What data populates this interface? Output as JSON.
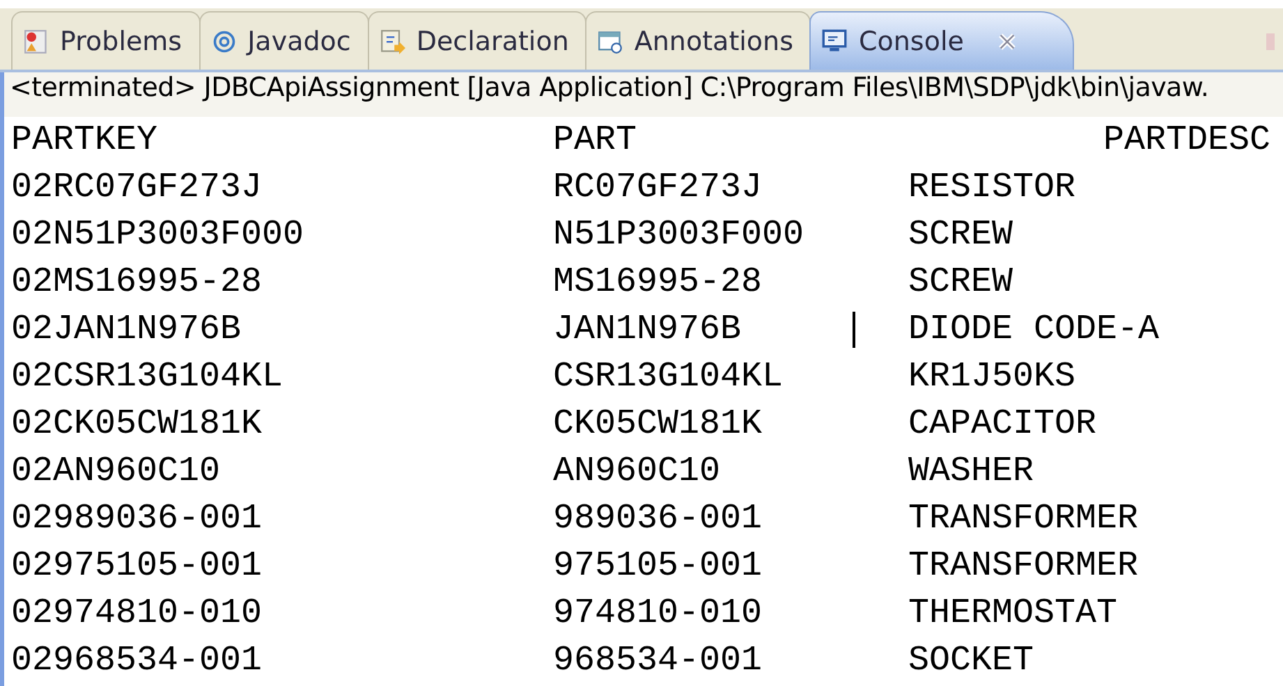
{
  "tabs": [
    {
      "label": "Problems",
      "kind": "problems",
      "selected": false,
      "closable": false
    },
    {
      "label": "Javadoc",
      "kind": "javadoc",
      "selected": false,
      "closable": false
    },
    {
      "label": "Declaration",
      "kind": "declaration",
      "selected": false,
      "closable": false
    },
    {
      "label": "Annotations",
      "kind": "annotations",
      "selected": false,
      "closable": false
    },
    {
      "label": "Console",
      "kind": "console",
      "selected": true,
      "closable": true
    }
  ],
  "status_line": "<terminated> JDBCApiAssignment [Java Application] C:\\Program Files\\IBM\\SDP\\jdk\\bin\\javaw.",
  "console": {
    "header": [
      "PARTKEY",
      "PART",
      "PARTDESC"
    ],
    "rows": [
      {
        "cells": [
          "02RC07GF273J",
          "RC07GF273J",
          "RESISTOR"
        ],
        "caret": false
      },
      {
        "cells": [
          "02N51P3003F000",
          "N51P3003F000",
          "SCREW"
        ],
        "caret": false
      },
      {
        "cells": [
          "02MS16995-28",
          "MS16995-28",
          "SCREW"
        ],
        "caret": false
      },
      {
        "cells": [
          "02JAN1N976B",
          "JAN1N976B",
          "DIODE CODE-A"
        ],
        "caret": true
      },
      {
        "cells": [
          "02CSR13G104KL",
          "CSR13G104KL",
          "KR1J50KS"
        ],
        "caret": false
      },
      {
        "cells": [
          "02CK05CW181K",
          "CK05CW181K",
          "CAPACITOR"
        ],
        "caret": false
      },
      {
        "cells": [
          "02AN960C10",
          "AN960C10",
          "WASHER"
        ],
        "caret": false
      },
      {
        "cells": [
          "02989036-001",
          "989036-001",
          "TRANSFORMER"
        ],
        "caret": false
      },
      {
        "cells": [
          "02975105-001",
          "975105-001",
          "TRANSFORMER"
        ],
        "caret": false
      },
      {
        "cells": [
          "02974810-010",
          "974810-010",
          "THERMOSTAT"
        ],
        "caret": false
      },
      {
        "cells": [
          "02968534-001",
          "968534-001",
          "SOCKET"
        ],
        "caret": false
      }
    ]
  }
}
